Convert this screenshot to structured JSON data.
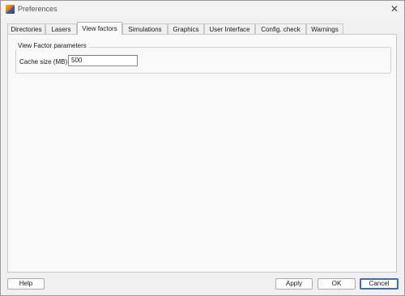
{
  "window": {
    "title": "Preferences",
    "close_glyph": "✕"
  },
  "tabs": [
    {
      "label": "Directories"
    },
    {
      "label": "Lasers"
    },
    {
      "label": "View factors",
      "active": true
    },
    {
      "label": "Simulations"
    },
    {
      "label": "Graphics"
    },
    {
      "label": "User Interface"
    },
    {
      "label": "Config. check"
    },
    {
      "label": "Warnings"
    }
  ],
  "group": {
    "title": "View Factor parameters",
    "cache_label": "Cache size (MB):",
    "cache_value": "500"
  },
  "buttons": {
    "help": "Help",
    "apply": "Apply",
    "ok": "OK",
    "cancel": "Cancel"
  },
  "colors": {
    "default_button_border": "#3d6fb6",
    "background": "#f0f0f0"
  }
}
